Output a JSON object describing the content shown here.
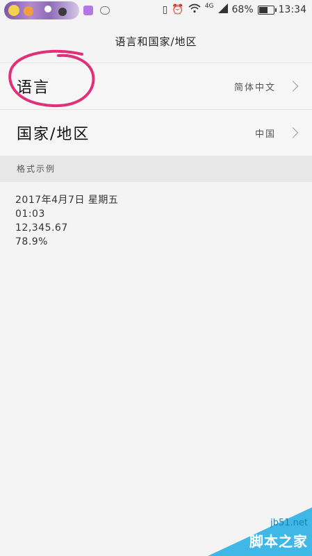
{
  "status_bar": {
    "network": "4G",
    "battery": "68%",
    "battery_level": 0.68,
    "time": "13:34"
  },
  "header": {
    "title": "语言和国家/地区"
  },
  "settings": [
    {
      "label": "语言",
      "value": "简体中文"
    },
    {
      "label": "国家/地区",
      "value": "中国"
    }
  ],
  "format_section": {
    "title": "格式示例",
    "samples": [
      "2017年4月7日 星期五",
      "01:03",
      "12,345.67",
      "78.9%"
    ]
  },
  "annotation": {
    "circle_color": "#e0307a"
  },
  "watermark": {
    "site": "jb51.net",
    "name": "脚本之家",
    "color": "#3fb8e8"
  }
}
